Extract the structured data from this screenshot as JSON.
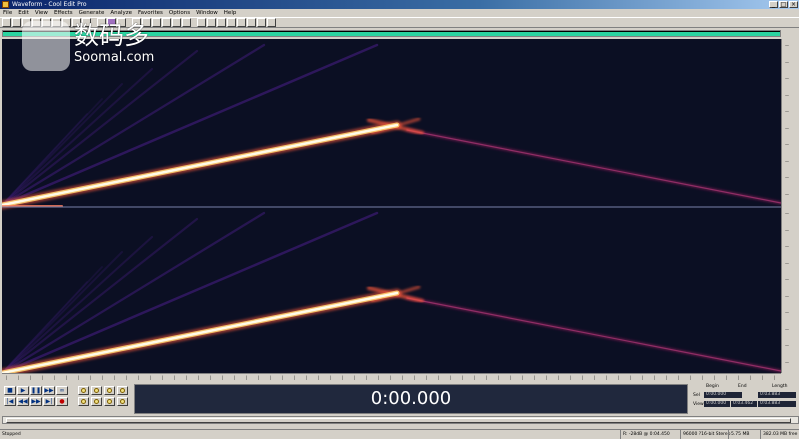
{
  "window": {
    "title": "Waveform - Cool Edit Pro"
  },
  "menu": [
    "File",
    "Edit",
    "View",
    "Effects",
    "Generate",
    "Analyze",
    "Favorites",
    "Options",
    "Window",
    "Help"
  ],
  "watermark": {
    "cn": "数码多",
    "en": "Soomal.com"
  },
  "transport": {
    "play_symbol": "▶",
    "stop_symbol": "■",
    "pause_symbol": "❚❚",
    "loop_symbol": "∞",
    "rewind_symbol": "◀◀",
    "ffwd_symbol": "▶▶",
    "start_symbol": "|◀",
    "end_symbol": "▶|",
    "record_symbol": "●"
  },
  "time_display": {
    "value": "0:00.000"
  },
  "selection_panel": {
    "col_begin": "Begin",
    "col_end": "End",
    "col_length": "Length",
    "row_sel": "Sel",
    "row_view": "View",
    "sel_begin": "0:00.000",
    "sel_length": "0:03.883",
    "view_begin": "0:00.000",
    "view_end": "0:03.462",
    "view_length": "0:03.883"
  },
  "status": {
    "state": "Stopped",
    "peak": "R: -28dB @ 0:04.450",
    "format": "96000 ?16-bit Stereo",
    "size": "5.75 MB",
    "free": "382.03 MB free"
  },
  "colors": {
    "background": "#0b0f23",
    "hot": "#fff6d8",
    "warm": "#ff5a3a",
    "mid": "#a02060",
    "cool": "#4a1f8a"
  }
}
